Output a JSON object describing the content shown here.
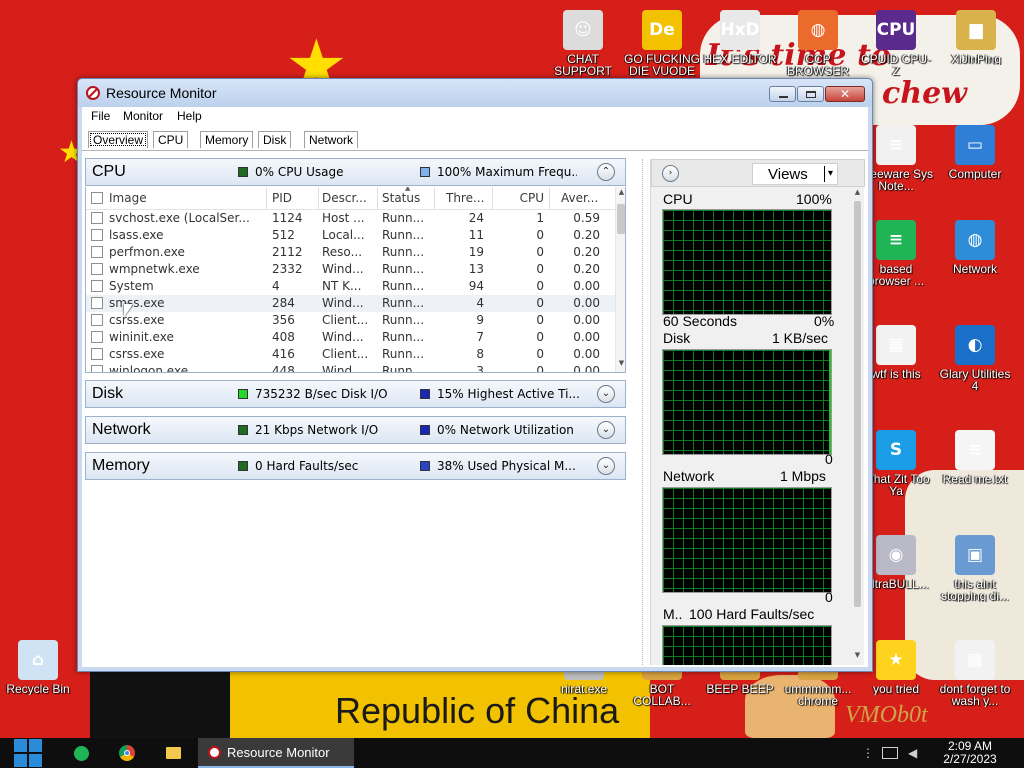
{
  "desktop": {
    "wallpaper_slogan_1": "It's time to",
    "wallpaper_slogan_2": "chew",
    "wallpaper_country": "Republic of China",
    "wallpaper_mark": "VMOb0t",
    "icons": [
      {
        "label": "CHAT SUPPORT",
        "icon": "doctor-icon",
        "glyph": "☺",
        "color": "#dcdcdc"
      },
      {
        "label": "GO FUCKING DIE VUODE",
        "icon": "de-app-icon",
        "glyph": "De",
        "color": "#f2c200"
      },
      {
        "label": "HEX EDITOR",
        "icon": "hex-editor-icon",
        "glyph": "HxD",
        "color": "#e9e9e9"
      },
      {
        "label": "CCP BROWSER",
        "icon": "browser-icon",
        "glyph": "◍",
        "color": "#ea6b2b"
      },
      {
        "label": "CPUID CPU-Z",
        "icon": "cpuz-icon",
        "glyph": "CPU",
        "color": "#5a2a8c"
      },
      {
        "label": "XiJinPing",
        "icon": "user-folder-icon",
        "glyph": "▆",
        "color": "#d8b24a"
      },
      {
        "label": "Freeware Sys Note...",
        "icon": "notes-icon",
        "glyph": "≡",
        "color": "#f1f1f1"
      },
      {
        "label": "Computer",
        "icon": "computer-icon",
        "glyph": "▭",
        "color": "#2f7fd6"
      },
      {
        "label": "based browser ...",
        "icon": "chat-app-icon",
        "glyph": "≡",
        "color": "#1fb557"
      },
      {
        "label": "Network",
        "icon": "network-globe-icon",
        "glyph": "◍",
        "color": "#2f8dd8"
      },
      {
        "label": "wtf is this",
        "icon": "calendar-file-icon",
        "glyph": "▦",
        "color": "#f2f2f2"
      },
      {
        "label": "Glary Utilities 4",
        "icon": "glary-icon",
        "glyph": "◐",
        "color": "#1a6fc9"
      },
      {
        "label": "What Zit Too Ya",
        "icon": "skype-icon",
        "glyph": "S",
        "color": "#1b9ee6"
      },
      {
        "label": "Read me.txt",
        "icon": "text-file-icon",
        "glyph": "≡",
        "color": "#f5f5f5"
      },
      {
        "label": "UltraBULL...",
        "icon": "disc-icon",
        "glyph": "◉",
        "color": "#b9b9c8"
      },
      {
        "label": "this aint stopping di...",
        "icon": "pc-setup-icon",
        "glyph": "▣",
        "color": "#6a9ad2"
      },
      {
        "label": "Recycle Bin",
        "icon": "recycle-bin-icon",
        "glyph": "⌂",
        "color": "#cfe3f5"
      },
      {
        "label": "nirat.exe",
        "icon": "exe-icon",
        "glyph": "▭",
        "color": "#bdbdbd"
      },
      {
        "label": "BOT COLLAB...",
        "icon": "bot-icon",
        "glyph": "▭",
        "color": "#d9a341"
      },
      {
        "label": "BEEP BEEP",
        "icon": "beep-icon",
        "glyph": "♪",
        "color": "#d9a341"
      },
      {
        "label": "ummmmm... chrome",
        "icon": "chrome-shortcut-icon",
        "glyph": "◍",
        "color": "#d9a341"
      },
      {
        "label": "you tried",
        "icon": "star-icon",
        "glyph": "★",
        "color": "#ffd21e"
      },
      {
        "label": "dont forget to wash y...",
        "icon": "calendar-file-icon",
        "glyph": "▦",
        "color": "#f2f2f2"
      }
    ]
  },
  "window": {
    "title": "Resource Monitor",
    "close_symbol": "✕",
    "menu": [
      "File",
      "Monitor",
      "Help"
    ],
    "tabs": [
      "Overview",
      "CPU",
      "Memory",
      "Disk",
      "Network"
    ],
    "active_tab": "Overview"
  },
  "cpu_section": {
    "title": "CPU",
    "stat1": "0% CPU Usage",
    "stat1_color": "#1f6b22",
    "stat2": "100% Maximum Frequ...",
    "stat2_color": "#7fb2ea",
    "toggle": "⌃",
    "columns": [
      "Image",
      "PID",
      "Descr...",
      "Status",
      "Thre...",
      "CPU",
      "Aver..."
    ],
    "rows": [
      {
        "image": "svchost.exe (LocalSer...",
        "pid": "1124",
        "desc": "Host ...",
        "status": "Runn...",
        "threads": "24",
        "cpu": "1",
        "avg": "0.59"
      },
      {
        "image": "lsass.exe",
        "pid": "512",
        "desc": "Local...",
        "status": "Runn...",
        "threads": "11",
        "cpu": "0",
        "avg": "0.20"
      },
      {
        "image": "perfmon.exe",
        "pid": "2112",
        "desc": "Reso...",
        "status": "Runn...",
        "threads": "19",
        "cpu": "0",
        "avg": "0.20"
      },
      {
        "image": "wmpnetwk.exe",
        "pid": "2332",
        "desc": "Wind...",
        "status": "Runn...",
        "threads": "13",
        "cpu": "0",
        "avg": "0.20"
      },
      {
        "image": "System",
        "pid": "4",
        "desc": "NT K...",
        "status": "Runn...",
        "threads": "94",
        "cpu": "0",
        "avg": "0.00"
      },
      {
        "image": "smss.exe",
        "pid": "284",
        "desc": "Wind...",
        "status": "Runn...",
        "threads": "4",
        "cpu": "0",
        "avg": "0.00"
      },
      {
        "image": "csrss.exe",
        "pid": "356",
        "desc": "Client...",
        "status": "Runn...",
        "threads": "9",
        "cpu": "0",
        "avg": "0.00"
      },
      {
        "image": "wininit.exe",
        "pid": "408",
        "desc": "Wind...",
        "status": "Runn...",
        "threads": "7",
        "cpu": "0",
        "avg": "0.00"
      },
      {
        "image": "csrss.exe",
        "pid": "416",
        "desc": "Client...",
        "status": "Runn...",
        "threads": "8",
        "cpu": "0",
        "avg": "0.00"
      },
      {
        "image": "winlogon.exe",
        "pid": "448",
        "desc": "Wind...",
        "status": "Runn...",
        "threads": "3",
        "cpu": "0",
        "avg": "0.00"
      }
    ]
  },
  "disk_section": {
    "title": "Disk",
    "stat1": "735232 B/sec Disk I/O",
    "stat1_color": "#22d92a",
    "stat2": "15% Highest Active Ti...",
    "stat2_color": "#1a26b8",
    "toggle": "⌄"
  },
  "network_section": {
    "title": "Network",
    "stat1": "21 Kbps Network I/O",
    "stat1_color": "#1f6b22",
    "stat2": "0% Network Utilization",
    "stat2_color": "#1a26b8",
    "toggle": "⌄"
  },
  "memory_section": {
    "title": "Memory",
    "stat1": "0 Hard Faults/sec",
    "stat1_color": "#1f6b22",
    "stat2": "38% Used Physical M...",
    "stat2_color": "#2a44c8",
    "toggle": "⌄"
  },
  "right_pane": {
    "expand_symbol": "›",
    "views_label": "Views",
    "views_caret": "▾",
    "graphs": {
      "cpu": {
        "name": "CPU",
        "max": "100%",
        "bottom_left": "60 Seconds",
        "bottom_right": "0%"
      },
      "disk": {
        "name": "Disk",
        "max": "1 KB/sec",
        "bottom_right": "0"
      },
      "network": {
        "name": "Network",
        "max": "1 Mbps",
        "bottom_right": "0"
      },
      "memory": {
        "name": "M..",
        "max": "100 Hard Faults/sec"
      }
    }
  },
  "taskbar": {
    "active_window": "Resource Monitor",
    "pinned": [
      "chat-app-icon",
      "chrome-icon",
      "folder-icon"
    ],
    "tray_overflow": "⋮",
    "clock_time": "2:09 AM",
    "clock_date": "2/27/2023"
  }
}
